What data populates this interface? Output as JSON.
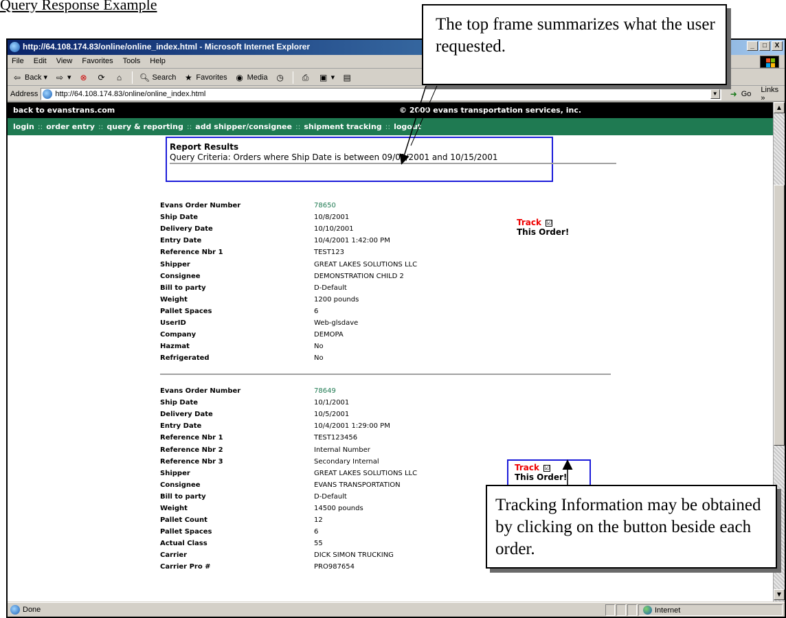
{
  "doc": {
    "title": "Query Response Example"
  },
  "browser": {
    "title": "http://64.108.174.83/online/online_index.html - Microsoft Internet Explorer",
    "window_buttons": [
      "_",
      "□",
      "X"
    ],
    "menu": [
      "File",
      "Edit",
      "View",
      "Favorites",
      "Tools",
      "Help"
    ],
    "toolbar": {
      "back": "Back",
      "search": "Search",
      "favorites": "Favorites",
      "media": "Media"
    },
    "address": {
      "label": "Address",
      "url": "http://64.108.174.83/online/online_index.html",
      "go": "Go",
      "links": "Links »"
    },
    "status": {
      "text": "Done",
      "zone": "Internet"
    }
  },
  "site": {
    "back_link": "back to evanstrans.com",
    "copyright": "© 2000 evans transportation services, inc.",
    "nav": [
      "login",
      "order entry",
      "query & reporting",
      "add shipper/consignee",
      "shipment tracking",
      "logout"
    ],
    "nav_sep": "::"
  },
  "report": {
    "title": "Report Results",
    "criteria": "Query Criteria: Orders where Ship Date is between 09/01/2001 and 10/15/2001"
  },
  "orders": [
    {
      "rows": [
        {
          "k": "Evans Order Number",
          "v": "78650"
        },
        {
          "k": "Ship Date",
          "v": "10/8/2001"
        },
        {
          "k": "Delivery Date",
          "v": "10/10/2001"
        },
        {
          "k": "Entry Date",
          "v": "10/4/2001 1:42:00 PM"
        },
        {
          "k": "Reference Nbr 1",
          "v": "TEST123"
        },
        {
          "k": "Shipper",
          "v": "GREAT LAKES SOLUTIONS LLC"
        },
        {
          "k": "Consignee",
          "v": "DEMONSTRATION CHILD 2"
        },
        {
          "k": "Bill to party",
          "v": "D-Default"
        },
        {
          "k": "Weight",
          "v": "1200 pounds"
        },
        {
          "k": "Pallet Spaces",
          "v": "6"
        },
        {
          "k": "UserID",
          "v": "Web-glsdave"
        },
        {
          "k": "Company",
          "v": "DEMOPA"
        },
        {
          "k": "Hazmat",
          "v": "No"
        },
        {
          "k": "Refrigerated",
          "v": "No"
        }
      ]
    },
    {
      "rows": [
        {
          "k": "Evans Order Number",
          "v": "78649"
        },
        {
          "k": "Ship Date",
          "v": "10/1/2001"
        },
        {
          "k": "Delivery Date",
          "v": "10/5/2001"
        },
        {
          "k": "Entry Date",
          "v": "10/4/2001 1:29:00 PM"
        },
        {
          "k": "Reference Nbr 1",
          "v": "TEST123456"
        },
        {
          "k": "Reference Nbr 2",
          "v": "Internal Number"
        },
        {
          "k": "Reference Nbr 3",
          "v": "Secondary Internal"
        },
        {
          "k": "Shipper",
          "v": "GREAT LAKES SOLUTIONS LLC"
        },
        {
          "k": "Consignee",
          "v": "EVANS TRANSPORTATION"
        },
        {
          "k": "Bill to party",
          "v": "D-Default"
        },
        {
          "k": "Weight",
          "v": "14500 pounds"
        },
        {
          "k": "Pallet Count",
          "v": "12"
        },
        {
          "k": "Pallet Spaces",
          "v": "6"
        },
        {
          "k": "Actual Class",
          "v": "55"
        },
        {
          "k": "Carrier",
          "v": "DICK SIMON TRUCKING"
        },
        {
          "k": "Carrier Pro #",
          "v": "PRO987654"
        }
      ]
    }
  ],
  "track": {
    "label": "Track",
    "sub": "This Order!",
    "checkbox": "☑"
  },
  "callouts": {
    "top": "The top frame summarizes what the user requested.",
    "bottom": "Tracking Information may be obtained by clicking on the button beside each order."
  }
}
